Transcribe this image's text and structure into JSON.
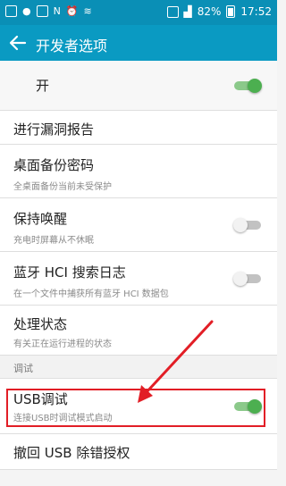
{
  "status_bar": {
    "left_icons": [
      "grid-icon",
      "chat-icon",
      "mail-icon",
      "nfc-icon",
      "alarm-icon",
      "wifi-icon",
      "sim-icon",
      "signal-icon"
    ],
    "battery": "82%",
    "time": "17:52",
    "nfc_label": "N"
  },
  "app_bar": {
    "title": "开发者选项"
  },
  "master_switch": {
    "label": "开",
    "on": true
  },
  "items": [
    {
      "title": "进行漏洞报告",
      "subtitle": ""
    },
    {
      "title": "桌面备份密码",
      "subtitle": "全桌面备份当前未受保护"
    },
    {
      "title": "保持唤醒",
      "subtitle": "充电时屏幕从不休眠",
      "switch": false
    },
    {
      "title": "蓝牙 HCI 搜索日志",
      "subtitle": "在一个文件中捕获所有蓝牙 HCI 数据包",
      "switch": false
    },
    {
      "title": "处理状态",
      "subtitle": "有关正在运行进程的状态"
    }
  ],
  "debug_section": {
    "label": "调试"
  },
  "usb_debug": {
    "title": "USB调试",
    "subtitle": "连接USB时调试模式启动",
    "on": true
  },
  "revoke": {
    "title": "撤回 USB 除错授权"
  },
  "colors": {
    "app_bar": "#0a9ac2",
    "status_bar": "#0a8fb6",
    "switch_on": "#4caf50",
    "annotation": "#e21e26"
  }
}
